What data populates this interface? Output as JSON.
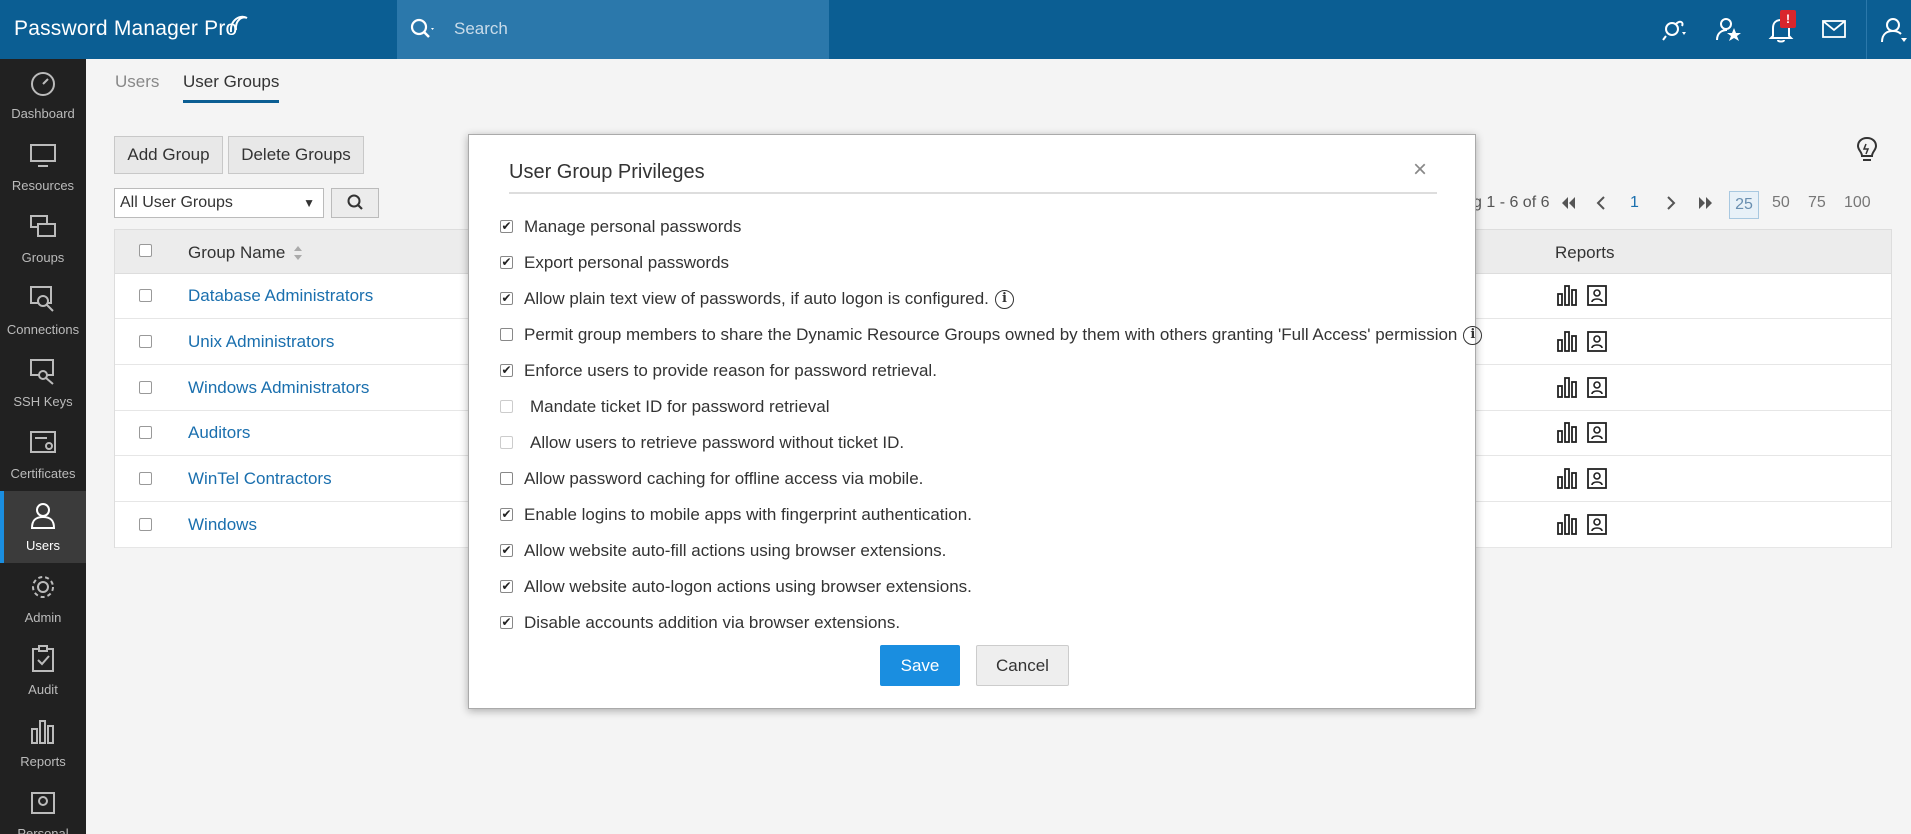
{
  "app": {
    "logo_text": "Password Manager Pro"
  },
  "search": {
    "placeholder": "Search"
  },
  "topbar": {
    "notification_badge": "!",
    "icons": [
      "connections-icon",
      "favorites-icon",
      "bell-icon",
      "mail-icon",
      "user-icon"
    ]
  },
  "sidebar": {
    "items": [
      {
        "label": "Dashboard",
        "icon": "speedometer-icon"
      },
      {
        "label": "Resources",
        "icon": "monitor-icon"
      },
      {
        "label": "Groups",
        "icon": "groups-icon"
      },
      {
        "label": "Connections",
        "icon": "connections-icon"
      },
      {
        "label": "SSH Keys",
        "icon": "ssh-key-icon"
      },
      {
        "label": "Certificates",
        "icon": "certificate-icon"
      },
      {
        "label": "Users",
        "icon": "user-icon",
        "active": true
      },
      {
        "label": "Admin",
        "icon": "gear-icon"
      },
      {
        "label": "Audit",
        "icon": "clipboard-icon"
      },
      {
        "label": "Reports",
        "icon": "bar-chart-icon"
      },
      {
        "label": "Personal",
        "icon": "personal-icon"
      }
    ]
  },
  "tabs": [
    {
      "label": "Users",
      "active": false
    },
    {
      "label": "User Groups",
      "active": true
    }
  ],
  "toolbar": {
    "add_group": "Add Group",
    "delete_groups": "Delete Groups",
    "filter_value": "All User Groups",
    "filter_caret": "▼"
  },
  "pagination": {
    "summary": "g 1 - 6 of 6",
    "current_page": "1",
    "page_sizes": [
      "25",
      "50",
      "75",
      "100"
    ],
    "selected_size": "25"
  },
  "table": {
    "columns": {
      "group_name": "Group Name",
      "reports": "Reports"
    },
    "rows": [
      {
        "name": "Database Administrators"
      },
      {
        "name": "Unix Administrators"
      },
      {
        "name": "Windows Administrators"
      },
      {
        "name": "Auditors"
      },
      {
        "name": "WinTel Contractors"
      },
      {
        "name": "Windows"
      }
    ]
  },
  "modal": {
    "title": "User Group Privileges",
    "close": "×",
    "privileges": [
      {
        "label": "Manage personal passwords",
        "checked": true,
        "disabled": false
      },
      {
        "label": "Export personal passwords",
        "checked": true,
        "disabled": false
      },
      {
        "label": "Allow plain text view of passwords, if auto logon is configured.",
        "checked": true,
        "disabled": false,
        "info": true
      },
      {
        "label": "Permit group members to share the Dynamic Resource Groups owned by them with others granting 'Full Access' permission",
        "checked": false,
        "disabled": false,
        "info": true
      },
      {
        "label": "Enforce users to provide reason for password retrieval.",
        "checked": true,
        "disabled": false
      },
      {
        "label": "Mandate ticket ID for password retrieval",
        "checked": false,
        "disabled": true
      },
      {
        "label": "Allow users to retrieve password without ticket ID.",
        "checked": false,
        "disabled": true
      },
      {
        "label": "Allow password caching for offline access via mobile.",
        "checked": false,
        "disabled": false
      },
      {
        "label": "Enable logins to mobile apps with fingerprint authentication.",
        "checked": true,
        "disabled": false
      },
      {
        "label": "Allow website auto-fill actions using browser extensions.",
        "checked": true,
        "disabled": false
      },
      {
        "label": "Allow website auto-logon actions using browser extensions.",
        "checked": true,
        "disabled": false
      },
      {
        "label": "Disable accounts addition via browser extensions.",
        "checked": true,
        "disabled": false
      }
    ],
    "save_label": "Save",
    "cancel_label": "Cancel"
  }
}
